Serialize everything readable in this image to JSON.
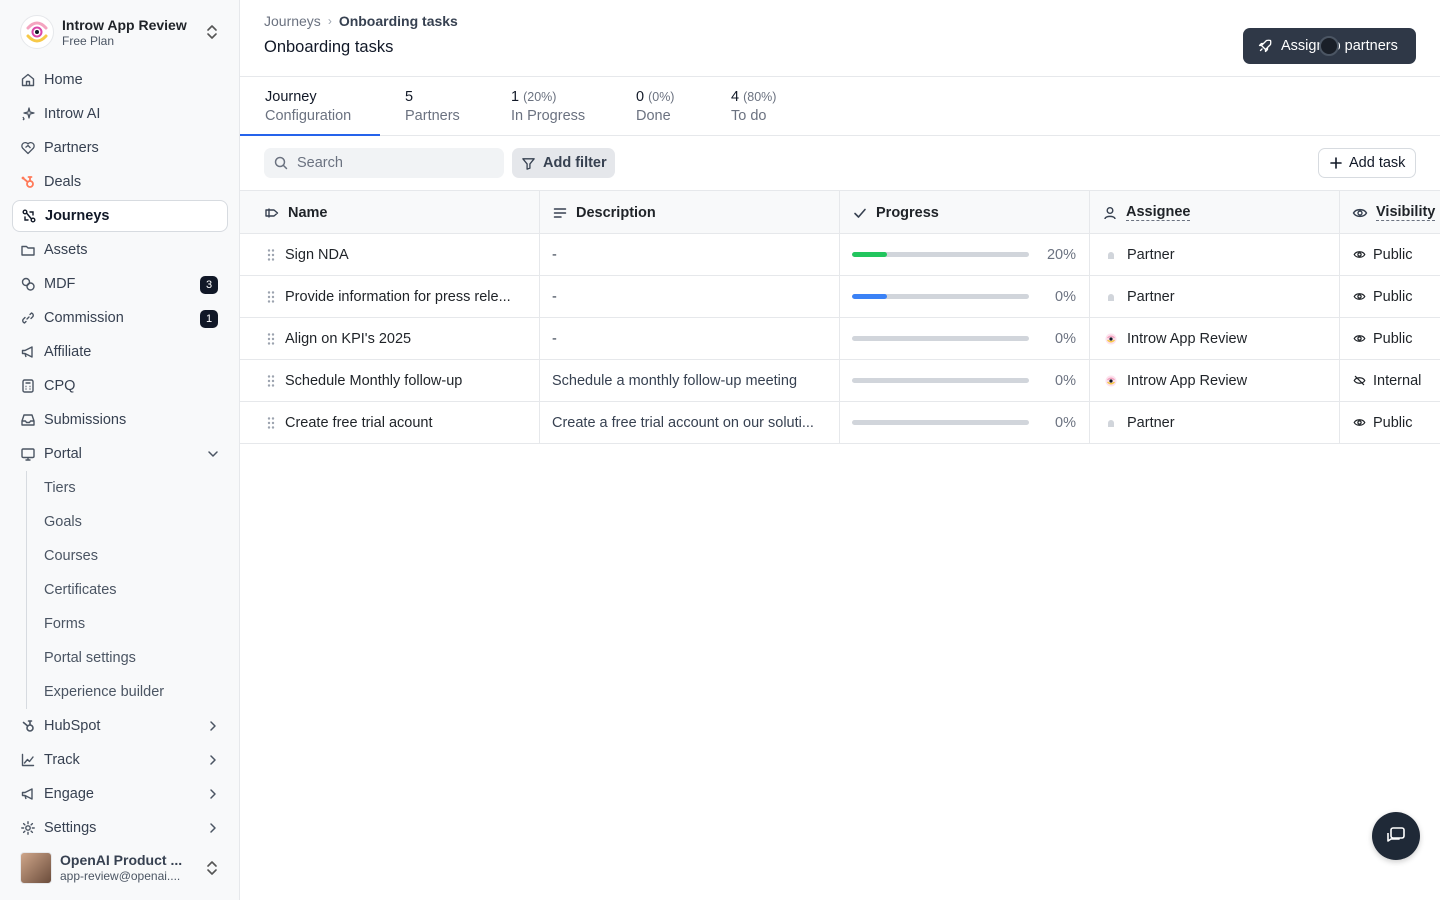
{
  "workspace": {
    "name": "Introw App Review",
    "plan": "Free Plan"
  },
  "sidebar": {
    "items": [
      {
        "label": "Home",
        "icon": "home-icon"
      },
      {
        "label": "Introw AI",
        "icon": "sparkle-icon"
      },
      {
        "label": "Partners",
        "icon": "handshake-icon"
      },
      {
        "label": "Deals",
        "icon": "hubspot-icon"
      },
      {
        "label": "Journeys",
        "icon": "journey-icon",
        "active": true
      },
      {
        "label": "Assets",
        "icon": "folder-icon"
      },
      {
        "label": "MDF",
        "icon": "coins-icon",
        "badge": "3"
      },
      {
        "label": "Commission",
        "icon": "link-icon",
        "badge": "1"
      },
      {
        "label": "Affiliate",
        "icon": "megaphone-icon"
      },
      {
        "label": "CPQ",
        "icon": "calculator-icon"
      },
      {
        "label": "Submissions",
        "icon": "inbox-icon"
      },
      {
        "label": "Portal",
        "icon": "monitor-icon",
        "expanded": true
      }
    ],
    "portal_sub": [
      "Tiers",
      "Goals",
      "Courses",
      "Certificates",
      "Forms",
      "Portal settings",
      "Experience builder"
    ],
    "bottom_items": [
      {
        "label": "HubSpot",
        "icon": "hubspot-icon"
      },
      {
        "label": "Track",
        "icon": "chart-icon"
      },
      {
        "label": "Engage",
        "icon": "megaphone-icon"
      },
      {
        "label": "Settings",
        "icon": "gear-icon"
      }
    ]
  },
  "user": {
    "name": "OpenAI Product ...",
    "email": "app-review@openai...."
  },
  "breadcrumb": {
    "parent": "Journeys",
    "current": "Onboarding tasks"
  },
  "page_title": "Onboarding tasks",
  "assign_button": "Assign to partners",
  "tabs": [
    {
      "num": "Journey",
      "pct": "",
      "label": "Configuration",
      "active": true
    },
    {
      "num": "5",
      "pct": "",
      "label": "Partners"
    },
    {
      "num": "1",
      "pct": "(20%)",
      "label": "In Progress"
    },
    {
      "num": "0",
      "pct": "(0%)",
      "label": "Done"
    },
    {
      "num": "4",
      "pct": "(80%)",
      "label": "To do"
    }
  ],
  "search": {
    "placeholder": "Search"
  },
  "filter_button": "Add filter",
  "add_task_button": "Add task",
  "table": {
    "columns": {
      "name": "Name",
      "description": "Description",
      "progress": "Progress",
      "assignee": "Assignee",
      "visibility": "Visibility"
    },
    "rows": [
      {
        "name": "Sign NDA",
        "description": "-",
        "progress": 0.2,
        "progress_label": "20%",
        "progress_color": "#22c55e",
        "assignee": "Partner",
        "assignee_type": "partner",
        "visibility": "Public"
      },
      {
        "name": "Provide information for press rele...",
        "description": "-",
        "progress": 0.2,
        "progress_label": "0%",
        "progress_color": "#3b82f6",
        "assignee": "Partner",
        "assignee_type": "partner",
        "visibility": "Public"
      },
      {
        "name": "Align on KPI's 2025",
        "description": "-",
        "progress": 0,
        "progress_label": "0%",
        "progress_color": "#3b82f6",
        "assignee": "Introw App Review",
        "assignee_type": "company",
        "visibility": "Public"
      },
      {
        "name": "Schedule Monthly follow-up",
        "description": "Schedule a monthly follow-up meeting",
        "progress": 0,
        "progress_label": "0%",
        "progress_color": "#3b82f6",
        "assignee": "Introw App Review",
        "assignee_type": "company",
        "visibility": "Internal"
      },
      {
        "name": "Create free trial acount",
        "description": "Create a free trial account on our soluti...",
        "progress": 0,
        "progress_label": "0%",
        "progress_color": "#3b82f6",
        "assignee": "Partner",
        "assignee_type": "partner",
        "visibility": "Public"
      }
    ]
  },
  "colors": {
    "accent": "#2563eb",
    "primary_button": "#2f3847",
    "progress_done": "#22c55e",
    "progress_in": "#3b82f6"
  }
}
